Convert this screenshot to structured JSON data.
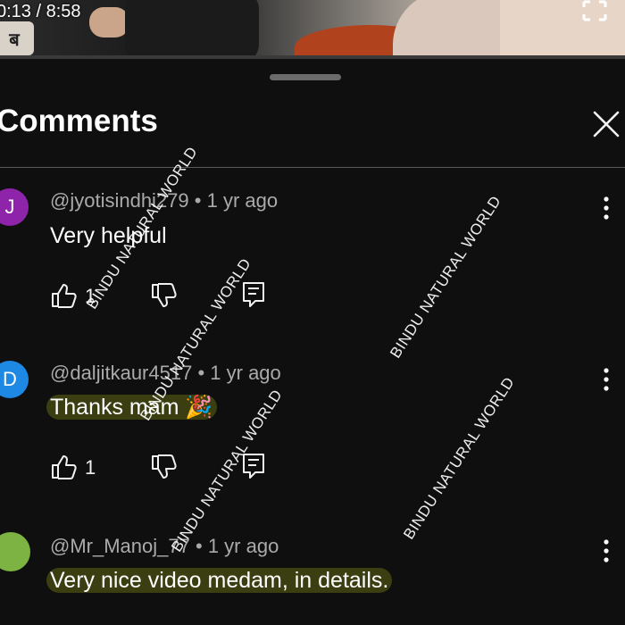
{
  "player": {
    "timecode": "0:13 / 8:58",
    "badge_text": "ब"
  },
  "panel": {
    "title": "Comments"
  },
  "comments": [
    {
      "avatar_letter": "J",
      "avatar_color": "#8e24aa",
      "author": "@jyotisindhi279",
      "age": "1 yr ago",
      "text": "Very helpful",
      "likes": "1"
    },
    {
      "avatar_letter": "D",
      "avatar_color": "#1e88e5",
      "author": "@daljitkaur4517",
      "age": "1 yr ago",
      "text": "Thanks mam 🎉",
      "likes": "1"
    },
    {
      "avatar_letter": "",
      "avatar_color": "#7cb342",
      "author": "@Mr_Manoj_77",
      "age": "1 yr ago",
      "text": "Very nice video medam, in details.",
      "likes": ""
    }
  ],
  "watermarks": [
    "BINDU NATURAL WORLD",
    "BINDU NATURAL WORLD",
    "BINDU NATURAL WORLD",
    "BINDU NATURAL WORLD",
    "BINDU NATURAL WORLD",
    "BINDU NATURAL WORLD"
  ],
  "colors": {
    "background": "#0f0f0f",
    "highlight": "#6e7814"
  }
}
